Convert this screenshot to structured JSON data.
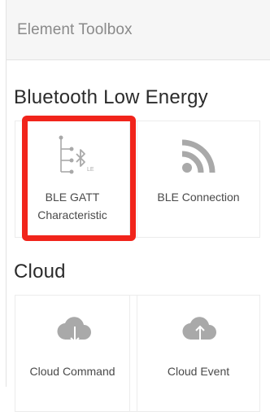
{
  "panel": {
    "title": "Element Toolbox"
  },
  "sections": [
    {
      "title": "Bluetooth Low Energy",
      "items": [
        {
          "label_line1": "BLE GATT",
          "label_line2": "Characteristic",
          "icon": "ble-gatt-characteristic-icon",
          "highlighted": true
        },
        {
          "label": "BLE Connection",
          "icon": "wifi-signal-icon"
        }
      ]
    },
    {
      "title": "Cloud",
      "items": [
        {
          "label": "Cloud Command",
          "icon": "cloud-download-icon"
        },
        {
          "label": "Cloud Event",
          "icon": "cloud-upload-icon"
        }
      ]
    }
  ],
  "colors": {
    "highlight": "#f1241b",
    "icon": "#a9a9a9",
    "header_bg": "#f6f6f6"
  }
}
